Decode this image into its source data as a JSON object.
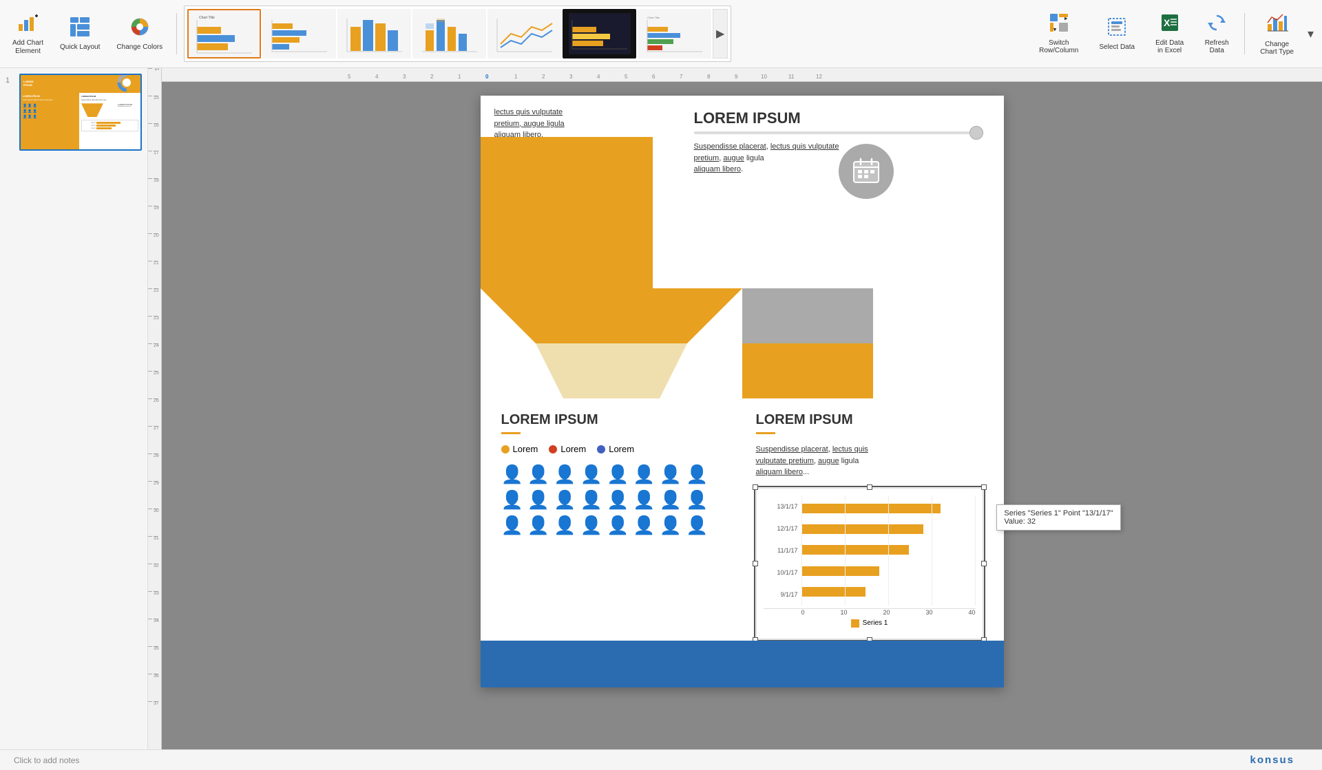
{
  "toolbar": {
    "add_chart_element_label": "Add Chart\nElement",
    "quick_layout_label": "Quick\nLayout",
    "change_colors_label": "Change\nColors",
    "switch_row_col_label": "Switch\nRow/Column",
    "select_data_label": "Select\nData",
    "edit_data_excel_label": "Edit Data\nin Excel",
    "refresh_data_label": "Refresh\nData",
    "change_chart_type_label": "Change\nChart Type",
    "scroll_arrow_label": "▶"
  },
  "sidebar": {
    "slide_number": "1"
  },
  "slide": {
    "top_right_title": "LOREM IPSUM",
    "top_right_desc": "Suspendisse placerat, lectus quis vulputate pretium, augue ligula aliquam libero.",
    "top_left_text1": "lectus quis vulputate pretium, augue ligula aliquam libero.",
    "lorem_ipsum_main": "LOREM IPSUM",
    "lorem_ipsum_desc_bottom": "Suspendisse placerat, lectus quis vulputate pretium, augue ligula aliquam libero.",
    "bottom_left_title": "LOREM IPSUM",
    "bottom_right_title": "LOREM IPSUM",
    "bottom_right_desc": "Suspendisse placerat, lectus quis vulputate pretium, augue ligula aliquam...",
    "legend_items": [
      {
        "color": "#e8a020",
        "label": "Lorem"
      },
      {
        "color": "#d04020",
        "label": "Lorem"
      },
      {
        "color": "#4060c0",
        "label": "Lorem"
      }
    ],
    "chart": {
      "title": "Series 1",
      "tooltip_series": "Series \"Series 1\" Point \"13/1/17\"",
      "tooltip_value": "Value: 32",
      "y_labels": [
        "13/1/17",
        "12/1/17",
        "11/1/17",
        "10/1/17",
        "9/1/17"
      ],
      "x_labels": [
        "0",
        "10",
        "20",
        "30",
        "40"
      ],
      "bars": [
        {
          "label": "13/1/17",
          "value": 32,
          "width_pct": 80
        },
        {
          "label": "12/1/17",
          "value": 28,
          "width_pct": 70
        },
        {
          "label": "11/1/17",
          "value": 25,
          "width_pct": 62
        },
        {
          "label": "10/1/17",
          "value": 18,
          "width_pct": 45
        },
        {
          "label": "9/1/17",
          "value": 15,
          "width_pct": 37
        }
      ],
      "series_label": "Series 1"
    }
  },
  "notes": {
    "click_to_add": "Click to add notes"
  },
  "brand": {
    "konsus": "konsus"
  },
  "colors": {
    "yellow": "#e8a020",
    "blue": "#2b6cb0",
    "gray": "#888888",
    "dark_blue": "#1a4e7a",
    "red": "#d04020",
    "chart_blue": "#4060c0"
  }
}
